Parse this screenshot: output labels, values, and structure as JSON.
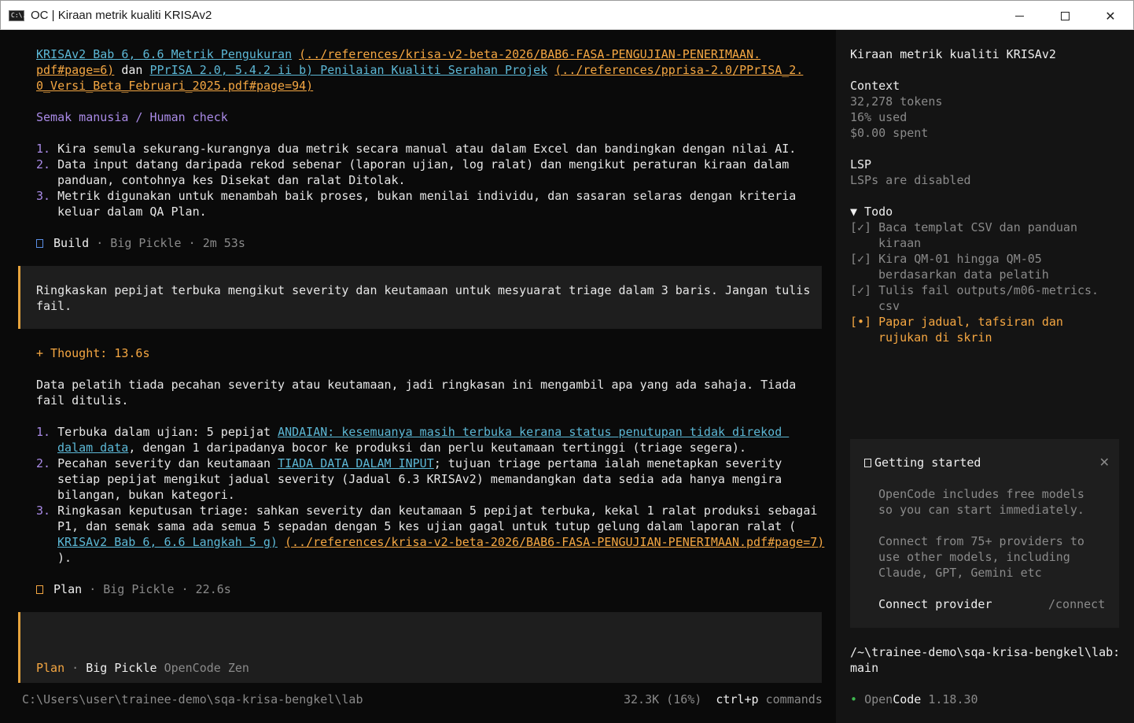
{
  "window": {
    "title": "OC | Kiraan metrik kualiti KRISAv2",
    "icon_text": "C:\\."
  },
  "transcript": {
    "refs": [
      {
        "text": "KRISAv2 Bab 6, 6.6 Metrik Pengukuran",
        "style": "link"
      },
      {
        "text": "(../references/krisa-v2-beta-2026/BAB6-FASA-PENGUJIAN-PENERIMAAN.",
        "style": "orange"
      },
      {
        "text": "pdf#page=6)",
        "style": "orange"
      },
      {
        "text": "dan",
        "style": "plain"
      },
      {
        "text": "PPrISA 2.0, 5.4.2 ii b) Penilaian Kualiti Serahan Projek",
        "style": "link"
      },
      {
        "text": "(../references/pprisa-2.0/PPrISA_2.",
        "style": "orange"
      },
      {
        "text": "0_Versi_Beta_Februari_2025.pdf#page=94)",
        "style": "orange"
      }
    ],
    "human_check_heading": "Semak manusia / Human check",
    "checks": [
      [
        "1.",
        "Kira semula sekurang-kurangnya dua metrik secara manual atau dalam Excel dan bandingkan dengan nilai AI."
      ],
      [
        "2.",
        "Data input datang daripada rekod sebenar (laporan ujian, log ralat) dan mengikut peraturan kiraan dalam"
      ],
      [
        "",
        "panduan, contohnya kes Disekat dan ralat Ditolak."
      ],
      [
        "3.",
        "Metrik digunakan untuk menambah baik proses, bukan menilai individu, dan sasaran selaras dengan kriteria"
      ],
      [
        "",
        "keluar dalam QA Plan."
      ]
    ],
    "build_meta": {
      "mode": "Build",
      "model": "Big Pickle",
      "duration": "2m 53s",
      "sep": "·"
    },
    "prompt1": [
      "Ringkaskan pepijat terbuka mengikut severity dan keutamaan untuk mesyuarat triage dalam 3 baris. Jangan tulis",
      "fail."
    ],
    "thought": "+ Thought: 13.6s",
    "reply_intro": [
      "Data pelatih tiada pecahan severity atau keutamaan, jadi ringkasan ini mengambil apa yang ada sahaja. Tiada",
      "fail ditulis."
    ],
    "items": {
      "i1_num": "1.",
      "i1_a": "Terbuka dalam ujian: 5 pepijat ",
      "i1_link1": "ANDAIAN: kesemuanya masih terbuka kerana status penutupan tidak direkod ",
      "i1_link2": "dalam data",
      "i1_b": ", dengan 1 daripadanya bocor ke produksi dan perlu keutamaan tertinggi (triage segera).",
      "i2_num": "2.",
      "i2_a": "Pecahan severity dan keutamaan ",
      "i2_link": "TIADA DATA DALAM INPUT",
      "i2_b": "; tujuan triage pertama ialah menetapkan severity",
      "i2_c": "setiap pepijat mengikut jadual severity (Jadual 6.3 KRISAv2) memandangkan data sedia ada hanya mengira",
      "i2_d": "bilangan, bukan kategori.",
      "i3_num": "3.",
      "i3_a": "Ringkasan keputusan triage: sahkan severity dan keutamaan 5 pepijat terbuka, kekal 1 ralat produksi sebagai",
      "i3_b": "P1, dan semak sama ada semua 5 sepadan dengan 5 kes ujian gagal untuk tutup gelung dalam laporan ralat (",
      "i3_link": "KRISAv2 Bab 6, 6.6 Langkah 5 g)",
      "i3_orange": "(../references/krisa-v2-beta-2026/BAB6-FASA-PENGUJIAN-PENERIMAAN.pdf#page=7)",
      "i3_end": ")."
    },
    "plan_meta": {
      "mode": "Plan",
      "model": "Big Pickle",
      "duration": "22.6s",
      "sep": "·"
    },
    "input_status": {
      "mode": "Plan",
      "sep": "·",
      "model": "Big Pickle",
      "provider": "OpenCode Zen"
    }
  },
  "statusbar": {
    "path": "C:\\Users\\user\\trainee-demo\\sqa-krisa-bengkel\\lab",
    "context": "32.3K (16%)",
    "shortcut_key": "ctrl+p",
    "shortcut_label": "commands"
  },
  "sidebar": {
    "title": "Kiraan metrik kualiti KRISAv2",
    "context_heading": "Context",
    "tokens": "32,278 tokens",
    "used": "16% used",
    "spent": "$0.00 spent",
    "lsp_heading": "LSP",
    "lsp_status": "LSPs are disabled",
    "todo_heading": "▼ Todo",
    "todos": [
      {
        "mark": "[✓]",
        "lines": [
          "Baca templat CSV dan panduan",
          "kiraan"
        ],
        "state": "done"
      },
      {
        "mark": "[✓]",
        "lines": [
          "Kira QM-01 hingga QM-05",
          "berdasarkan data pelatih"
        ],
        "state": "done"
      },
      {
        "mark": "[✓]",
        "lines": [
          "Tulis fail outputs/m06-metrics.",
          "csv"
        ],
        "state": "done"
      },
      {
        "mark": "[•]",
        "lines": [
          "Papar jadual, tafsiran dan",
          "rujukan di skrin"
        ],
        "state": "active"
      }
    ],
    "getting_started": {
      "title": "Getting started",
      "close": "✕",
      "p1": [
        "OpenCode includes free models",
        "so you can start immediately."
      ],
      "p2": [
        "Connect from 75+ providers to",
        "use other models, including",
        "Claude, GPT, Gemini etc"
      ],
      "connect_label": "Connect provider",
      "connect_cmd": "/connect"
    },
    "cwd": [
      "/~\\trainee-demo\\sqa-krisa-bengkel\\lab:",
      "main"
    ],
    "footer_dot": "•",
    "footer_brand_a": "Open",
    "footer_brand_b": "Code",
    "footer_version": "1.18.30"
  },
  "colors": {
    "accent_bar": "#e6a33d",
    "link": "#5cb8d6",
    "path_link": "#f5a742",
    "heading_purple": "#a98ae6",
    "success_dot": "#3fb950"
  }
}
